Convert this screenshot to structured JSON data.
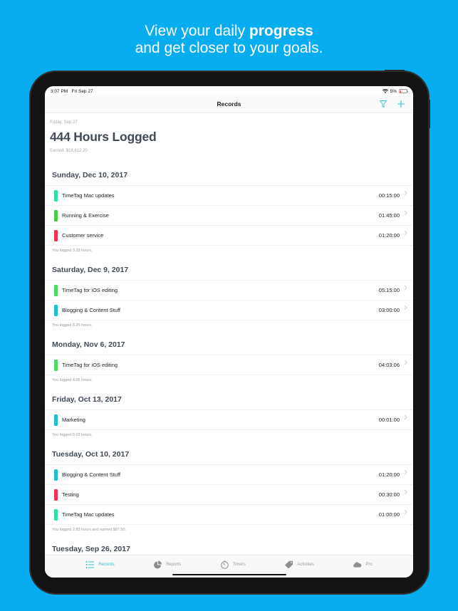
{
  "promo": {
    "line1_pre": "View your daily ",
    "line1_bold": "progress",
    "line2": "and get closer to your goals."
  },
  "status_bar": {
    "time": "3:07 PM",
    "date": "Fri Sep 27",
    "battery": "5%",
    "wifi_icon": "wifi-icon"
  },
  "nav": {
    "title": "Records",
    "filter_icon": "filter-icon",
    "add_icon": "plus-icon"
  },
  "colors": {
    "accent": "#2EC4CF",
    "background": "#08ADF0",
    "mint": "#2DDFA8",
    "green": "#44CC4A",
    "red": "#F5304F",
    "teal": "#1EBFC9"
  },
  "summary": {
    "date": "Friday, Sep 27",
    "hours_logged": "444 Hours Logged",
    "earned": "Earned: $18,612.20"
  },
  "sections": [
    {
      "header": "Sunday, Dec 10, 2017",
      "rows": [
        {
          "name": "TimeTag Mac updates",
          "duration": "00:15:00",
          "color": "#2DDFA8"
        },
        {
          "name": "Running & Exercise",
          "duration": "01:45:00",
          "color": "#44CC4A"
        },
        {
          "name": "Customer service",
          "duration": "01:20:00",
          "color": "#F5304F"
        }
      ],
      "footer": "You logged 3.33 hours."
    },
    {
      "header": "Saturday, Dec 9, 2017",
      "rows": [
        {
          "name": "TimeTag for iOS editing",
          "duration": "05:15:00",
          "color": "#4CD964"
        },
        {
          "name": "Blogging & Content Stuff",
          "duration": "03:00:00",
          "color": "#1EBFC9"
        }
      ],
      "footer": "You logged 8.25 hours."
    },
    {
      "header": "Monday, Nov 6, 2017",
      "rows": [
        {
          "name": "TimeTag for iOS editing",
          "duration": "04:03:06",
          "color": "#4CD964"
        }
      ],
      "footer": "You logged 4.05 hours."
    },
    {
      "header": "Friday, Oct 13, 2017",
      "rows": [
        {
          "name": "Marketing",
          "duration": "00:01:00",
          "color": "#1EBFC9"
        }
      ],
      "footer": "You logged 0.02 hours."
    },
    {
      "header": "Tuesday, Oct 10, 2017",
      "rows": [
        {
          "name": "Blogging & Content Stuff",
          "duration": "01:20:00",
          "color": "#1EBFC9"
        },
        {
          "name": "Testing",
          "duration": "00:30:00",
          "color": "#F5304F"
        },
        {
          "name": "TimeTag Mac updates",
          "duration": "01:00:00",
          "color": "#2DDFA8"
        }
      ],
      "footer": "You logged 2.83 hours and earned $87.50."
    },
    {
      "header": "Tuesday, Sep 26, 2017",
      "rows": [],
      "footer": ""
    }
  ],
  "tabs": [
    {
      "label": "Records",
      "icon": "list-icon",
      "active": true
    },
    {
      "label": "Reports",
      "icon": "pie-chart-icon",
      "active": false
    },
    {
      "label": "Timers",
      "icon": "stopwatch-icon",
      "active": false
    },
    {
      "label": "Activities",
      "icon": "tag-icon",
      "active": false
    },
    {
      "label": "Pro",
      "icon": "cloud-icon",
      "active": false
    }
  ]
}
